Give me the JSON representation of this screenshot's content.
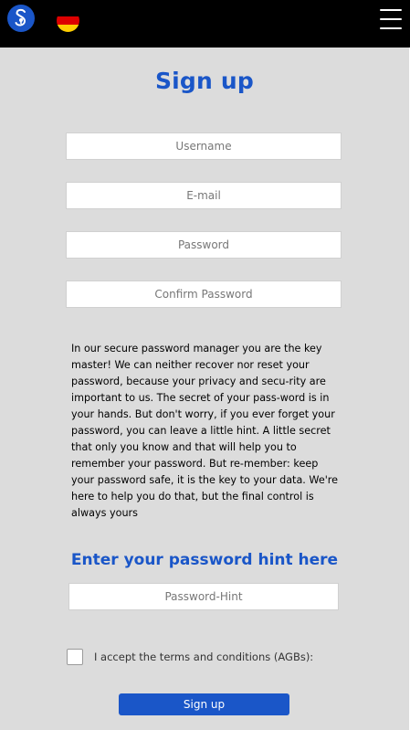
{
  "header": {
    "logo_icon": "lock-s-logo-icon",
    "language_icon": "german-flag-icon",
    "menu_icon": "hamburger-menu-icon"
  },
  "form": {
    "title": "Sign up",
    "username_placeholder": "Username",
    "email_placeholder": "E-mail",
    "password_placeholder": "Password",
    "confirm_password_placeholder": "Confirm Password",
    "info_text": "In our secure password manager you are the key master! We can neither recover nor reset your password, because your privacy and secu-rity are important to us. The secret of your pass-word is in your hands. But don't worry, if you ever forget your password, you can leave a little hint. A little secret that only you know and that will help you to remember your password. But re-member: keep your password safe, it is the key to your data. We're here to help you do that, but the final control is always yours",
    "hint_title": "Enter your password hint here",
    "hint_placeholder": "Password-Hint",
    "terms_label": "I accept the terms and conditions (AGBs):",
    "submit_label": "Sign up"
  },
  "colors": {
    "accent": "#1a56c8",
    "header_bg": "#000000",
    "page_bg": "#dcdcdc",
    "flag": [
      "#000000",
      "#dd0000",
      "#ffce00"
    ]
  }
}
